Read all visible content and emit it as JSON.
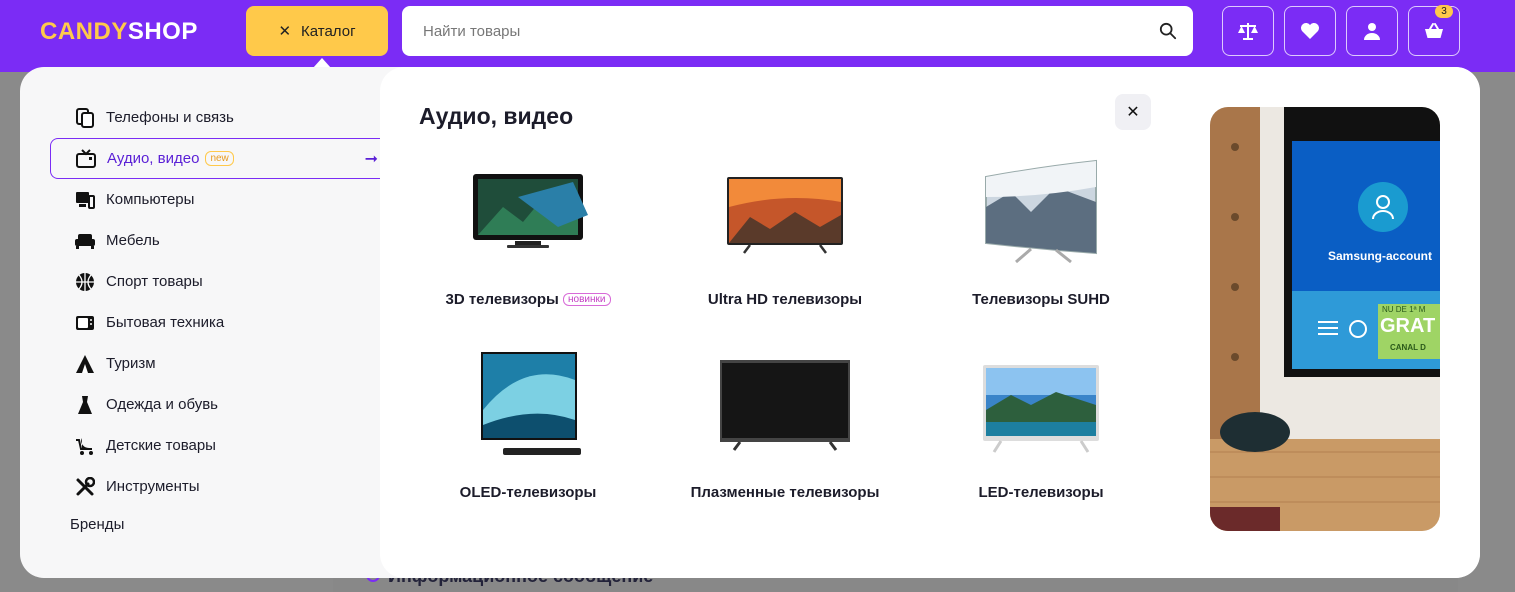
{
  "header": {
    "logo_part1": "CANDY",
    "logo_part2": "SHOP",
    "catalog_label": "Каталог",
    "search_placeholder": "Найти товары",
    "cart_count": "3"
  },
  "sidebar": {
    "items": [
      {
        "label": "Телефоны и связь",
        "icon": "phones-icon"
      },
      {
        "label": "Аудио, видео",
        "icon": "tv-icon",
        "tag": "new"
      },
      {
        "label": "Компьютеры",
        "icon": "computer-icon"
      },
      {
        "label": "Мебель",
        "icon": "sofa-icon"
      },
      {
        "label": "Спорт товары",
        "icon": "basketball-icon"
      },
      {
        "label": "Бытовая техника",
        "icon": "microwave-icon"
      },
      {
        "label": "Туризм",
        "icon": "tent-icon"
      },
      {
        "label": "Одежда и обувь",
        "icon": "dress-icon"
      },
      {
        "label": "Детские товары",
        "icon": "stroller-icon"
      },
      {
        "label": "Инструменты",
        "icon": "tools-icon"
      }
    ],
    "brands_label": "Бренды"
  },
  "panel": {
    "title": "Аудио, видео",
    "subcategories": [
      {
        "label": "3D телевизоры",
        "tag": "новинки"
      },
      {
        "label": "Ultra HD телевизоры"
      },
      {
        "label": "Телевизоры SUHD"
      },
      {
        "label": "OLED-телевизоры"
      },
      {
        "label": "Плазменные телевизоры"
      },
      {
        "label": "LED-телевизоры"
      }
    ]
  },
  "promo": {
    "account_label": "Samsung-account",
    "banner_text": "GRAT",
    "banner_small": "NU DE 1ª M",
    "banner_channel": "CANAL D"
  },
  "background": {
    "info_message": "Информационное сообщение"
  },
  "colors": {
    "brand_purple": "#7b2cf5",
    "accent_yellow": "#ffc94a"
  }
}
